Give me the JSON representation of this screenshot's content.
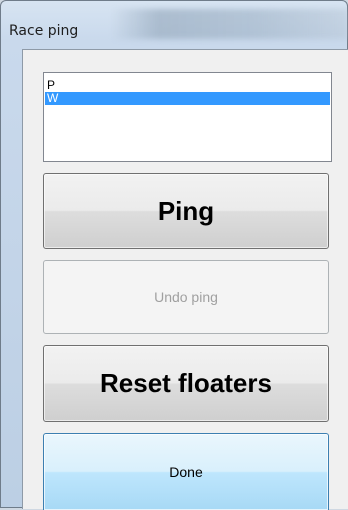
{
  "window": {
    "title": "Race ping"
  },
  "list": {
    "items": [
      {
        "label": "P",
        "selected": false
      },
      {
        "label": "W",
        "selected": true
      }
    ]
  },
  "buttons": {
    "ping_label": "Ping",
    "undo_label": "Undo ping",
    "undo_enabled": false,
    "reset_label": "Reset floaters",
    "done_label": "Done"
  },
  "colors": {
    "selection": "#3399ff",
    "disabled_text": "#a0a0a0",
    "focus_border": "#3c7fb1"
  }
}
